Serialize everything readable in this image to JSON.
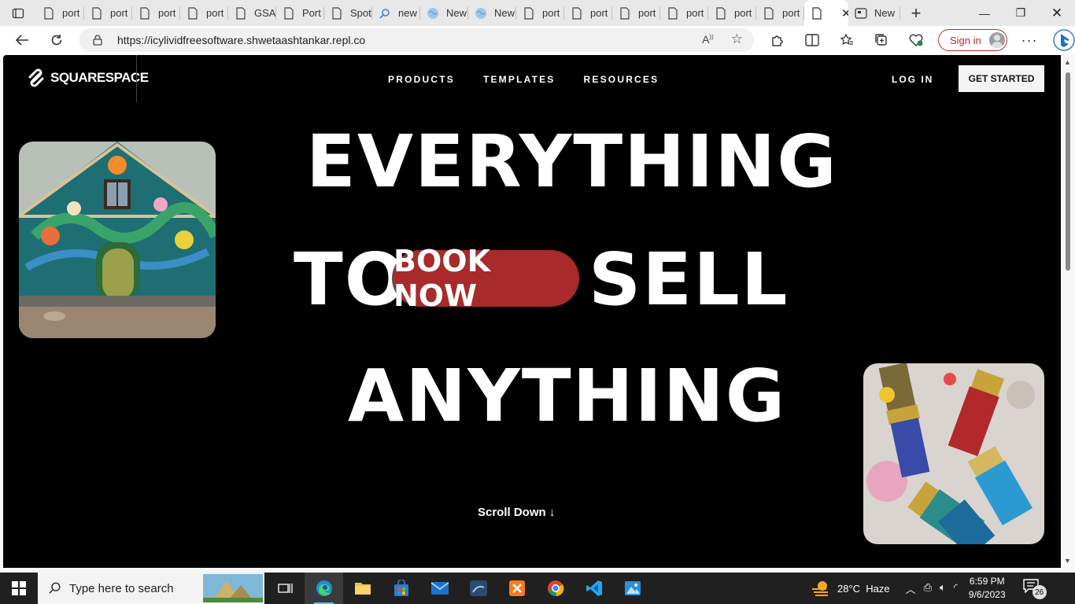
{
  "browser": {
    "tabs": [
      {
        "label": "port",
        "icon": "page-icon"
      },
      {
        "label": "port",
        "icon": "page-icon"
      },
      {
        "label": "port",
        "icon": "page-icon"
      },
      {
        "label": "port",
        "icon": "page-icon"
      },
      {
        "label": "GSA",
        "icon": "page-icon"
      },
      {
        "label": "Port",
        "icon": "page-icon"
      },
      {
        "label": "Spot",
        "icon": "page-icon"
      },
      {
        "label": "new",
        "icon": "search-icon"
      },
      {
        "label": "New",
        "icon": "globe-icon"
      },
      {
        "label": "New",
        "icon": "globe-icon"
      },
      {
        "label": "port",
        "icon": "page-icon"
      },
      {
        "label": "port",
        "icon": "page-icon"
      },
      {
        "label": "port",
        "icon": "page-icon"
      },
      {
        "label": "port",
        "icon": "page-icon"
      },
      {
        "label": "port",
        "icon": "page-icon"
      },
      {
        "label": "port",
        "icon": "page-icon"
      }
    ],
    "last_tab_label": "New",
    "url": "https://icylividfreesoftware.shwetaashtankar.repl.co",
    "signin_label": "Sign in"
  },
  "site": {
    "logo_text": "SQUARESPACE",
    "nav": {
      "products": "PRODUCTS",
      "templates": "TEMPLATES",
      "resources": "RESOURCES"
    },
    "login": "LOG IN",
    "get_started": "GET STARTED"
  },
  "hero": {
    "line1": "EVERYTHING",
    "line2_left": "TO",
    "book_now": "BOOK NOW",
    "line2_right": "SELL",
    "line3": "ANYTHING",
    "scroll_down": "Scroll Down ↓",
    "accent_color": "#a92a2a"
  },
  "taskbar": {
    "search_placeholder": "Type here to search",
    "weather": "28°C  Haze",
    "time": "6:59 PM",
    "date": "9/6/2023",
    "notification_count": "26"
  }
}
